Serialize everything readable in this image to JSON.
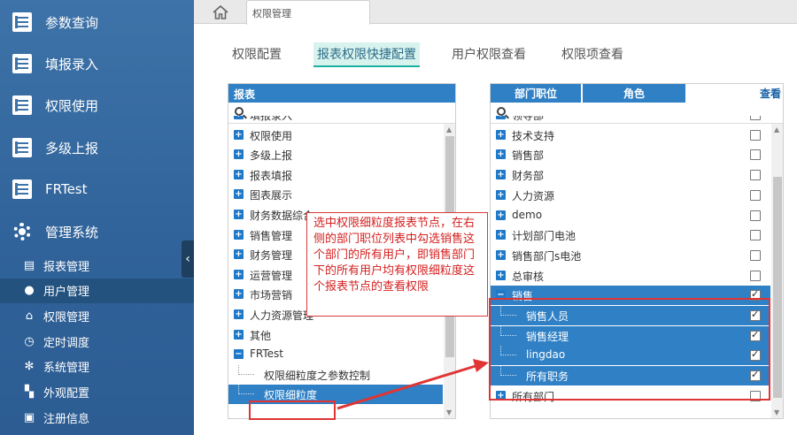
{
  "sidebar": {
    "main": [
      {
        "label": "参数查询",
        "icon": "list-icon"
      },
      {
        "label": "填报录入",
        "icon": "list-icon"
      },
      {
        "label": "权限使用",
        "icon": "list-icon"
      },
      {
        "label": "多级上报",
        "icon": "list-icon"
      },
      {
        "label": "FRTest",
        "icon": "list-icon"
      },
      {
        "label": "管理系统",
        "icon": "gear-icon"
      }
    ],
    "sub": [
      {
        "label": "报表管理",
        "icon": "report-icon",
        "glyph": "▤"
      },
      {
        "label": "用户管理",
        "icon": "user-icon",
        "glyph": "●"
      },
      {
        "label": "权限管理",
        "icon": "lock-icon",
        "glyph": "⌂"
      },
      {
        "label": "定时调度",
        "icon": "clock-icon",
        "glyph": "◷"
      },
      {
        "label": "系统管理",
        "icon": "cog-icon",
        "glyph": "✻"
      },
      {
        "label": "外观配置",
        "icon": "paint-icon",
        "glyph": "▚"
      },
      {
        "label": "注册信息",
        "icon": "register-icon",
        "glyph": "▣"
      }
    ],
    "active_sub": "用户管理",
    "collapse_glyph": "‹"
  },
  "topbar": {
    "tab_label": "权限管理"
  },
  "subtabs": [
    {
      "label": "权限配置",
      "active": false
    },
    {
      "label": "报表权限快捷配置",
      "active": true
    },
    {
      "label": "用户权限查看",
      "active": false
    },
    {
      "label": "权限项查看",
      "active": false
    }
  ],
  "left_panel": {
    "title": "报表",
    "rows": [
      {
        "label": "填报录入",
        "sign": "+",
        "type": "node"
      },
      {
        "label": "权限使用",
        "sign": "+",
        "type": "node"
      },
      {
        "label": "多级上报",
        "sign": "+",
        "type": "node"
      },
      {
        "label": "报表填报",
        "sign": "+",
        "type": "node"
      },
      {
        "label": "图表展示",
        "sign": "+",
        "type": "node"
      },
      {
        "label": "财务数据综合",
        "sign": "+",
        "type": "node"
      },
      {
        "label": "销售管理",
        "sign": "+",
        "type": "node"
      },
      {
        "label": "财务管理",
        "sign": "+",
        "type": "node"
      },
      {
        "label": "运营管理",
        "sign": "+",
        "type": "node"
      },
      {
        "label": "市场营销",
        "sign": "+",
        "type": "node"
      },
      {
        "label": "人力资源管理",
        "sign": "+",
        "type": "node"
      },
      {
        "label": "其他",
        "sign": "+",
        "type": "node"
      },
      {
        "label": "FRTest",
        "sign": "−",
        "type": "node"
      },
      {
        "label": "权限细粒度之参数控制",
        "sign": "",
        "type": "leaf"
      },
      {
        "label": "权限细粒度",
        "sign": "",
        "type": "leaf",
        "selected": true
      }
    ]
  },
  "right_panel": {
    "tabs": [
      {
        "label": "部门职位",
        "active": true
      },
      {
        "label": "角色",
        "active": false
      }
    ],
    "action_label": "查看",
    "rows": [
      {
        "label": "领导部",
        "sign": "+",
        "checked": false,
        "type": "node"
      },
      {
        "label": "技术支持",
        "sign": "+",
        "checked": false,
        "type": "node"
      },
      {
        "label": "销售部",
        "sign": "+",
        "checked": false,
        "type": "node"
      },
      {
        "label": "财务部",
        "sign": "+",
        "checked": false,
        "type": "node"
      },
      {
        "label": "人力资源",
        "sign": "+",
        "checked": false,
        "type": "node"
      },
      {
        "label": "demo",
        "sign": "+",
        "checked": false,
        "type": "node"
      },
      {
        "label": "计划部门电池",
        "sign": "+",
        "checked": false,
        "type": "node"
      },
      {
        "label": "销售部门s电池",
        "sign": "+",
        "checked": false,
        "type": "node"
      },
      {
        "label": "总审核",
        "sign": "+",
        "checked": false,
        "type": "node"
      },
      {
        "label": "销售",
        "sign": "−",
        "checked": true,
        "type": "node",
        "selected": true
      },
      {
        "label": "销售人员",
        "sign": "",
        "checked": true,
        "type": "leaf",
        "selected": true
      },
      {
        "label": "销售经理",
        "sign": "",
        "checked": true,
        "type": "leaf",
        "selected": true
      },
      {
        "label": "lingdao",
        "sign": "",
        "checked": true,
        "type": "leaf",
        "selected": true
      },
      {
        "label": "所有职务",
        "sign": "",
        "checked": true,
        "type": "leaf",
        "selected": true
      },
      {
        "label": "所有部门",
        "sign": "+",
        "checked": false,
        "type": "node"
      }
    ]
  },
  "annotation": {
    "text": "选中权限细粒度报表节点，在右侧的部门职位列表中勾选销售这个部门的所有用户，即销售部门下的所有用户均有权限细粒度这个报表节点的查看权限",
    "color": "#e03535"
  },
  "colors": {
    "accent": "#2f80c5",
    "sidebar": "#30639a",
    "highlight": "#e03535"
  }
}
